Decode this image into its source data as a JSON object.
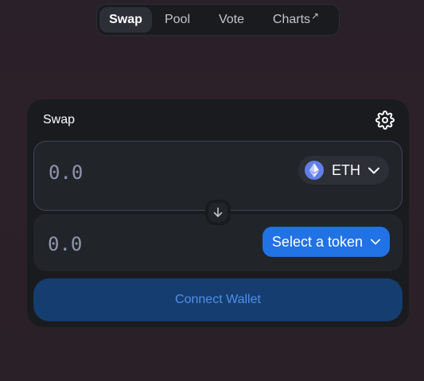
{
  "nav": {
    "items": [
      {
        "label": "Swap",
        "active": true
      },
      {
        "label": "Pool",
        "active": false
      },
      {
        "label": "Vote",
        "active": false
      },
      {
        "label": "Charts",
        "active": false
      }
    ],
    "external_arrow": "↗"
  },
  "swap_card": {
    "title": "Swap",
    "settings_icon": "gear-icon",
    "input": {
      "amount_placeholder": "0.0",
      "token": {
        "symbol": "ETH",
        "icon": "ethereum-logo-icon"
      }
    },
    "output": {
      "amount_placeholder": "0.0",
      "select_token_label": "Select a token"
    },
    "switch_icon": "arrow-down-icon",
    "connect_wallet_label": "Connect Wallet"
  },
  "colors": {
    "background": "#2a2029",
    "card": "#191b1f",
    "panel": "#212429",
    "accent_blue": "#2172e5",
    "connect_bg": "#153d6f",
    "connect_text": "#5090ea",
    "eth_blue": "#627eea"
  }
}
